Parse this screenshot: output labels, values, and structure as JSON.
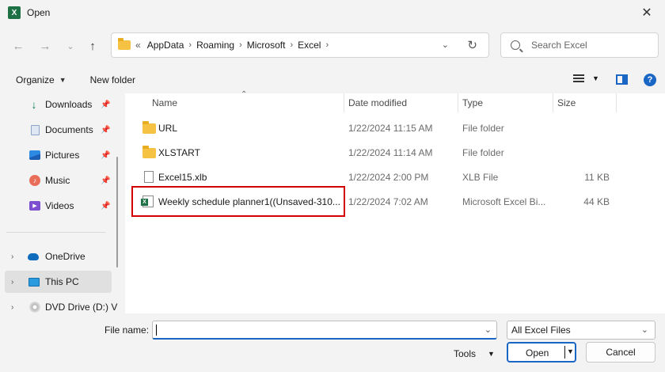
{
  "window": {
    "title": "Open",
    "app_icon": "excel-icon"
  },
  "nav": {
    "address": {
      "overflow": "«",
      "crumbs": [
        "AppData",
        "Roaming",
        "Microsoft",
        "Excel"
      ]
    },
    "search_placeholder": "Search Excel"
  },
  "toolbar": {
    "organize": "Organize",
    "new_folder": "New folder"
  },
  "sidebar": {
    "quick_access": [
      {
        "label": "Downloads",
        "icon": "download-icon"
      },
      {
        "label": "Documents",
        "icon": "document-icon"
      },
      {
        "label": "Pictures",
        "icon": "pictures-icon"
      },
      {
        "label": "Music",
        "icon": "music-icon"
      },
      {
        "label": "Videos",
        "icon": "videos-icon"
      }
    ],
    "locations": [
      {
        "label": "OneDrive",
        "icon": "onedrive-icon"
      },
      {
        "label": "This PC",
        "icon": "this-pc-icon",
        "selected": true
      },
      {
        "label": "DVD Drive (D:) V",
        "icon": "dvd-drive-icon"
      }
    ]
  },
  "columns": {
    "name": "Name",
    "date": "Date modified",
    "type": "Type",
    "size": "Size"
  },
  "files": [
    {
      "name": "URL",
      "date": "1/22/2024 11:15 AM",
      "type": "File folder",
      "size": "",
      "icon": "folder-icon"
    },
    {
      "name": "XLSTART",
      "date": "1/22/2024 11:14 AM",
      "type": "File folder",
      "size": "",
      "icon": "folder-icon"
    },
    {
      "name": "Excel15.xlb",
      "date": "1/22/2024 2:00 PM",
      "type": "XLB File",
      "size": "11 KB",
      "icon": "file-icon"
    },
    {
      "name": "Weekly schedule planner1((Unsaved-310...",
      "date": "1/22/2024 7:02 AM",
      "type": "Microsoft Excel Bi...",
      "size": "44 KB",
      "icon": "excel-file-icon"
    }
  ],
  "footer": {
    "file_name_label": "File name:",
    "file_name_value": "",
    "file_type": "All Excel Files",
    "tools": "Tools",
    "open": "Open",
    "cancel": "Cancel"
  },
  "colors": {
    "accent": "#1a66c5",
    "highlight": "#d20000",
    "excel": "#1e7145"
  }
}
